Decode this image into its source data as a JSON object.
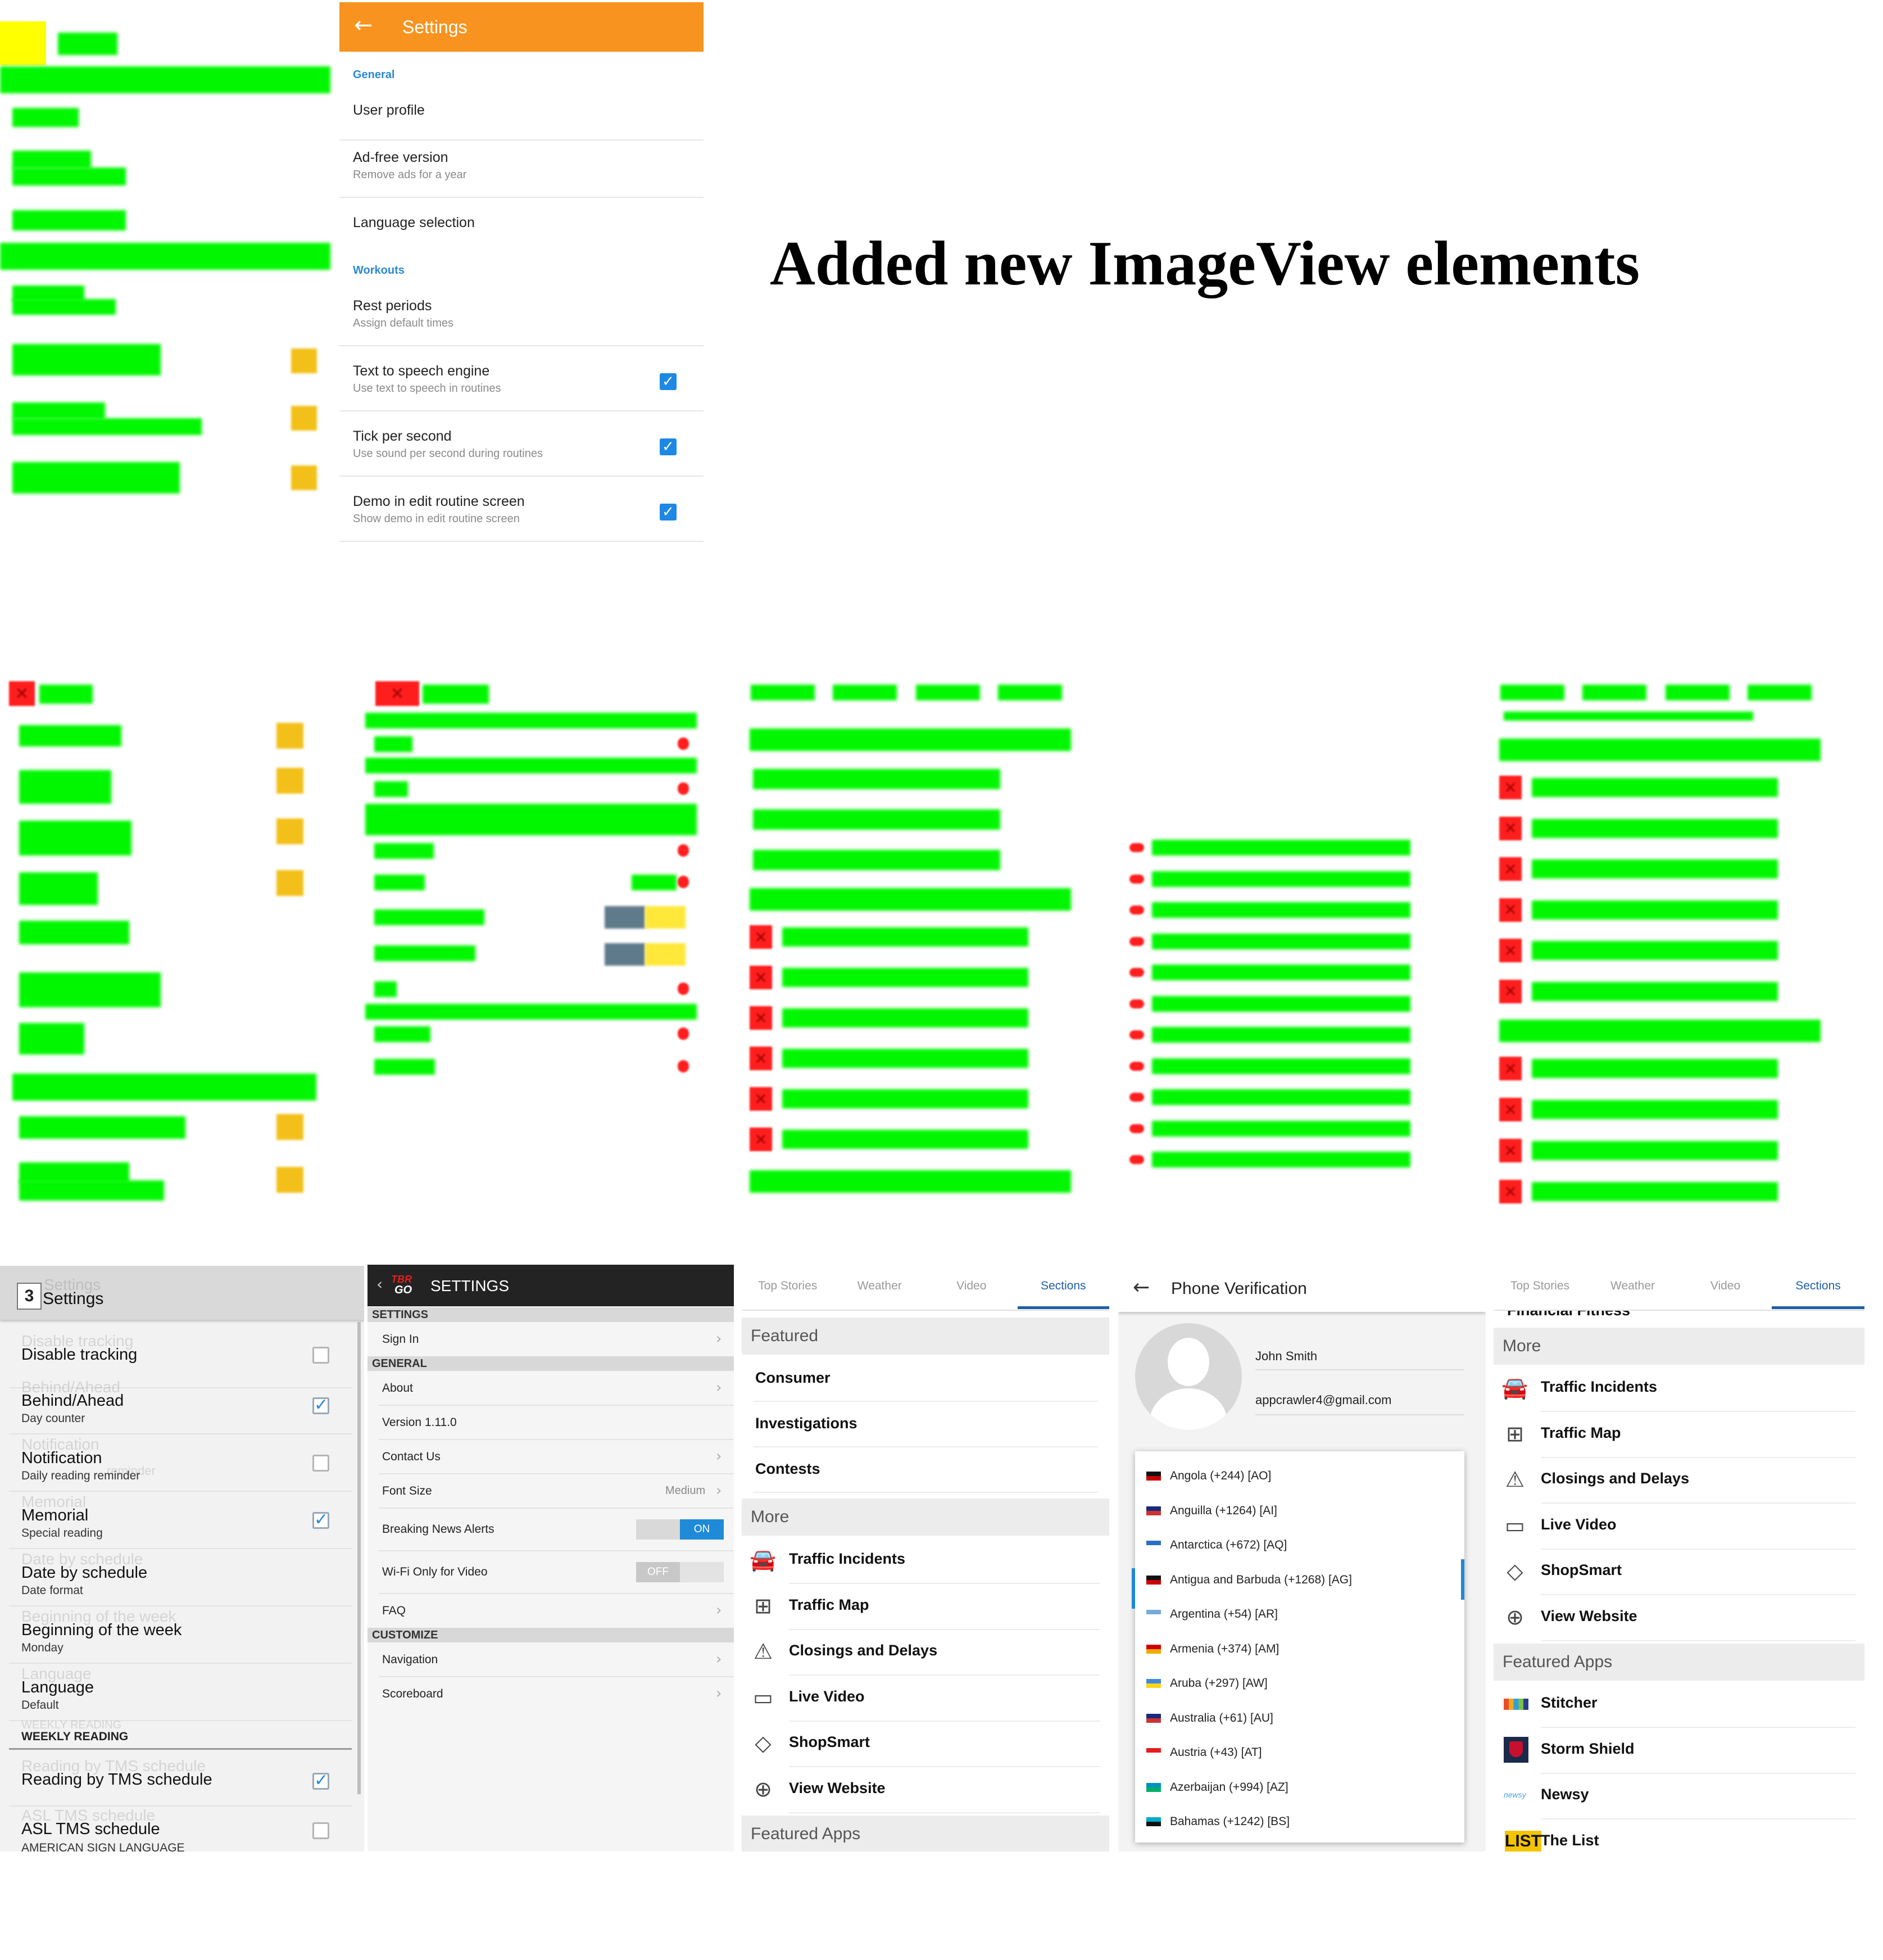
{
  "caption": "Added new ImageView elements",
  "settings_app": {
    "title": "Settings",
    "back_icon": "arrow-left-icon",
    "header_color": "#f7931e",
    "sections": [
      {
        "header": "General",
        "items": [
          {
            "title": "User profile",
            "subtitle": ""
          },
          {
            "title": "Ad-free version",
            "subtitle": "Remove ads for a year"
          },
          {
            "title": "Language selection",
            "subtitle": ""
          }
        ]
      },
      {
        "header": "Workouts",
        "items": [
          {
            "title": "Rest periods",
            "subtitle": "Assign default times"
          },
          {
            "title": "Text to speech engine",
            "subtitle": "Use text to speech in routines",
            "checked": true
          },
          {
            "title": "Tick per second",
            "subtitle": "Use sound per second during routines",
            "checked": true
          },
          {
            "title": "Demo in edit routine screen",
            "subtitle": "Show demo in edit routine screen",
            "checked": true
          }
        ]
      }
    ]
  },
  "bible_settings": {
    "title": "Settings",
    "title_ghost": "Settings",
    "icon_number": "3",
    "items": [
      {
        "title": "Disable tracking",
        "subtitle": "",
        "ghost": "Disable tracking",
        "checked": false
      },
      {
        "title": "Behind/Ahead",
        "subtitle": "Day counter",
        "ghost": "Behind/Ahead",
        "checked": true
      },
      {
        "title": "Notification",
        "subtitle": "Daily reading reminder",
        "ghost": "Notification",
        "ghost_sub": "reminder",
        "checked": false
      },
      {
        "title": "Memorial",
        "subtitle": "Special reading",
        "ghost": "Memorial",
        "checked": true
      },
      {
        "title": "Date by schedule",
        "subtitle": "Date format",
        "ghost": "Date by schedule"
      },
      {
        "title": "Beginning of the week",
        "subtitle": "Monday",
        "ghost": "Beginning of the week"
      },
      {
        "title": "Language",
        "subtitle": "Default",
        "ghost": "Language"
      }
    ],
    "section": "WEEKLY READING",
    "section_ghost": "WEEKLY READING",
    "items2": [
      {
        "title": "Reading by TMS schedule",
        "subtitle": "",
        "ghost": "Reading by TMS schedule",
        "checked": true
      },
      {
        "title": "ASL TMS schedule",
        "subtitle": "AMERICAN SIGN LANGUAGE",
        "ghost": "ASL TMS schedule",
        "checked": false
      }
    ]
  },
  "tbr_settings": {
    "title": "SETTINGS",
    "logo_top": "TBR",
    "logo_bottom": "GO",
    "groups": [
      {
        "header": "SETTINGS",
        "items": [
          {
            "label": "Sign In",
            "chevron": true
          }
        ]
      },
      {
        "header": "GENERAL",
        "items": [
          {
            "label": "About",
            "chevron": true
          },
          {
            "label": "Version 1.11.0",
            "chevron": false
          },
          {
            "label": "Contact Us",
            "chevron": true
          },
          {
            "label": "Font Size",
            "value": "Medium",
            "chevron": true
          },
          {
            "label": "Breaking News Alerts",
            "toggle": "ON"
          },
          {
            "label": "Wi-Fi Only for Video",
            "toggle": "OFF"
          },
          {
            "label": "FAQ",
            "chevron": true
          }
        ]
      },
      {
        "header": "CUSTOMIZE",
        "items": [
          {
            "label": "Navigation",
            "chevron": true
          },
          {
            "label": "Scoreboard",
            "chevron": true
          }
        ]
      }
    ]
  },
  "news_sections": {
    "tabs": [
      "Top Stories",
      "Weather",
      "Video",
      "Sections"
    ],
    "active_tab": "Sections",
    "accent": "#1f5ea8",
    "featured_header": "Featured",
    "featured": [
      "Consumer",
      "Investigations",
      "Contests"
    ],
    "more_header": "More",
    "more": [
      {
        "label": "Traffic Incidents",
        "icon": "car-icon"
      },
      {
        "label": "Traffic Map",
        "icon": "map-icon"
      },
      {
        "label": "Closings and Delays",
        "icon": "warning-icon"
      },
      {
        "label": "Live Video",
        "icon": "video-icon"
      },
      {
        "label": "ShopSmart",
        "icon": "tag-icon"
      },
      {
        "label": "View Website",
        "icon": "globe-icon"
      }
    ],
    "featured_apps_header": "Featured Apps"
  },
  "phone_verification": {
    "title": "Phone Verification",
    "name": "John Smith",
    "email": "appcrawler4@gmail.com",
    "countries": [
      "Angola (+244) [AO]",
      "Anguilla (+1264) [AI]",
      "Antarctica (+672) [AQ]",
      "Antigua and Barbuda (+1268) [AG]",
      "Argentina (+54) [AR]",
      "Armenia (+374) [AM]",
      "Aruba (+297) [AW]",
      "Australia (+61) [AU]",
      "Austria (+43) [AT]",
      "Azerbaijan (+994) [AZ]",
      "Bahamas (+1242) [BS]"
    ]
  },
  "news_sections_2": {
    "tabs": [
      "Top Stories",
      "Weather",
      "Video",
      "Sections"
    ],
    "active_tab": "Sections",
    "cut_label": "Financial Fitness",
    "more_header": "More",
    "more": [
      {
        "label": "Traffic Incidents",
        "icon": "car-icon"
      },
      {
        "label": "Traffic Map",
        "icon": "map-icon"
      },
      {
        "label": "Closings and Delays",
        "icon": "warning-icon"
      },
      {
        "label": "Live Video",
        "icon": "video-icon"
      },
      {
        "label": "ShopSmart",
        "icon": "tag-icon"
      },
      {
        "label": "View Website",
        "icon": "globe-icon"
      }
    ],
    "featured_apps_header": "Featured Apps",
    "apps": [
      {
        "label": "Stitcher",
        "icon": "stitcher-logo-icon"
      },
      {
        "label": "Storm Shield",
        "icon": "storm-shield-logo-icon"
      },
      {
        "label": "Newsy",
        "icon": "newsy-logo-icon",
        "logo_text": "newsy"
      },
      {
        "label": "The List",
        "icon": "the-list-logo-icon",
        "logo_text": "LIST"
      }
    ]
  }
}
